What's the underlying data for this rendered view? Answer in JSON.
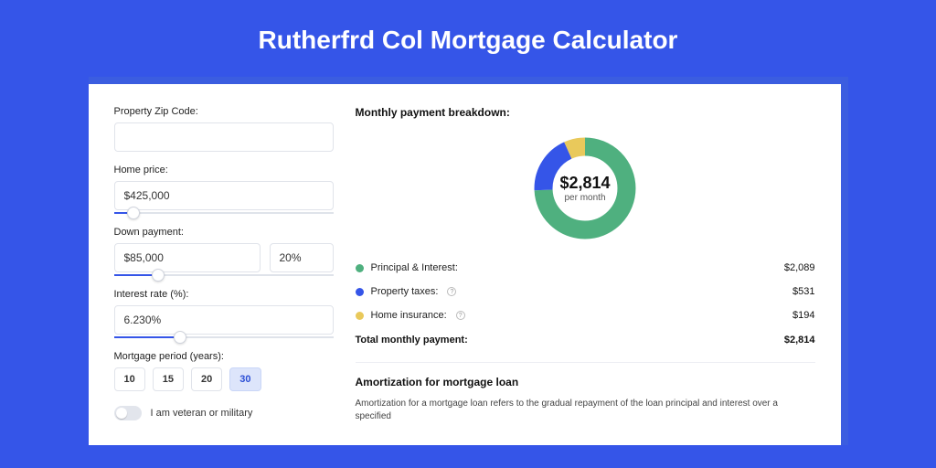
{
  "title": "Rutherfrd Col Mortgage Calculator",
  "form": {
    "zip": {
      "label": "Property Zip Code:",
      "value": ""
    },
    "homePrice": {
      "label": "Home price:",
      "value": "$425,000",
      "slider_pct": 9
    },
    "downPayment": {
      "label": "Down payment:",
      "value": "$85,000",
      "pct_value": "20%",
      "slider_pct": 20
    },
    "rate": {
      "label": "Interest rate (%):",
      "value": "6.230%",
      "slider_pct": 30
    },
    "period": {
      "label": "Mortgage period (years):",
      "options": [
        "10",
        "15",
        "20",
        "30"
      ],
      "selected": "30"
    },
    "veteran": {
      "label": "I am veteran or military"
    }
  },
  "breakdown": {
    "title": "Monthly payment breakdown:",
    "center_amount": "$2,814",
    "center_sub": "per month",
    "items": [
      {
        "label": "Principal & Interest:",
        "value": "$2,089",
        "color": "green",
        "info": false
      },
      {
        "label": "Property taxes:",
        "value": "$531",
        "color": "blue",
        "info": true
      },
      {
        "label": "Home insurance:",
        "value": "$194",
        "color": "yellow",
        "info": true
      }
    ],
    "total": {
      "label": "Total monthly payment:",
      "value": "$2,814"
    }
  },
  "amortization": {
    "title": "Amortization for mortgage loan",
    "text": "Amortization for a mortgage loan refers to the gradual repayment of the loan principal and interest over a specified"
  },
  "chart_data": {
    "type": "pie",
    "title": "Monthly payment breakdown",
    "series": [
      {
        "name": "Principal & Interest",
        "value": 2089,
        "color": "#4fb07f"
      },
      {
        "name": "Property taxes",
        "value": 531,
        "color": "#3555e8"
      },
      {
        "name": "Home insurance",
        "value": 194,
        "color": "#e9c95b"
      }
    ],
    "total": 2814
  }
}
